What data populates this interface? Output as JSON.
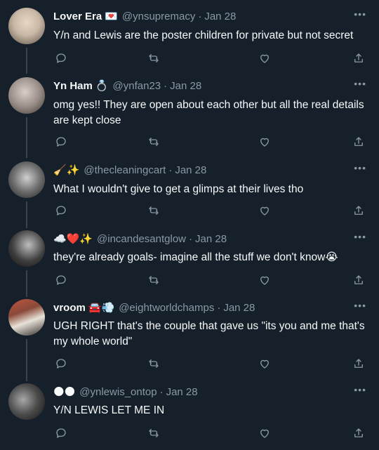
{
  "tweets": [
    {
      "name": "Lover Era",
      "emoji": "💌",
      "handle": "@ynsupremacy",
      "date": "Jan 28",
      "text": "Y/n and Lewis are the poster children for private but not secret",
      "avatar_color": "#c9b8a6"
    },
    {
      "name": "Yn Ham",
      "emoji": "💍",
      "handle": "@ynfan23",
      "date": "Jan 28",
      "text": "omg yes!! They are open about each other but all the real details are kept close",
      "avatar_color": "#9a8f88"
    },
    {
      "name": "",
      "emoji": "🧹✨",
      "handle": "@thecleaningcart",
      "date": "Jan 28",
      "text": "What I wouldn't give to get a glimps at their lives tho",
      "avatar_color": "#6f6f6f"
    },
    {
      "name": "",
      "emoji": "☁️❤️✨",
      "handle": "@incandesantglow",
      "date": "Jan 28",
      "text": "they're already goals- imagine all the stuff we don't know😭",
      "avatar_color": "#3e3e3e"
    },
    {
      "name": "vroom",
      "emoji": "🚘💨",
      "handle": "@eightworldchamps",
      "date": "Jan 28",
      "text": "UGH RIGHT that's the couple that gave us \"its you and me that's my whole world\"",
      "avatar_color": "#8a4a3a"
    },
    {
      "name": "",
      "emoji": "🌑🌑",
      "handle": "@ynlewis_ontop",
      "date": "Jan 28",
      "text": "Y/N LEWIS LET ME IN",
      "avatar_color": "#4b4b4b"
    }
  ],
  "ui": {
    "dot": "·",
    "more": "•••"
  },
  "colors": {
    "background": "#15202b",
    "text": "#f7f9f9",
    "muted": "#8b98a5"
  }
}
